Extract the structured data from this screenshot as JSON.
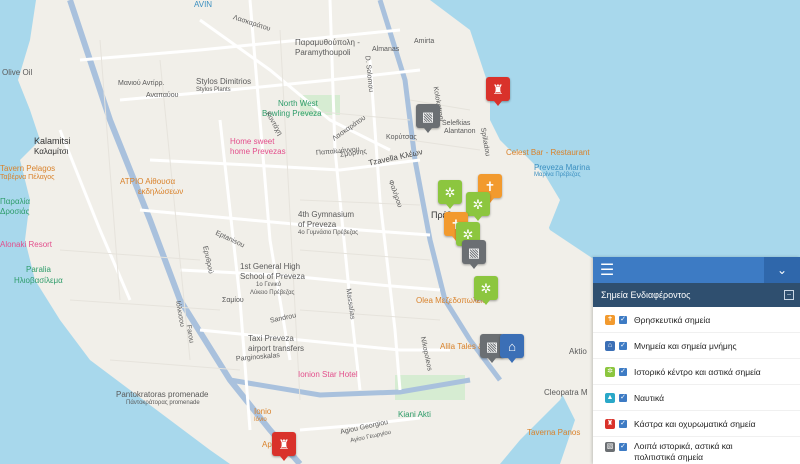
{
  "map": {
    "pois": [
      {
        "text": "Olive Oil",
        "color": "#5a5a5a"
      },
      {
        "text": "Kalamitsi",
        "color": "#333333"
      },
      {
        "text": "Καλαμίτσι",
        "color": "#333333"
      },
      {
        "text": "Tavern Pelagos",
        "color": "#d9822b"
      },
      {
        "text": "Ταβέρνα Πέλαγος",
        "color": "#d9822b"
      },
      {
        "text": "Παραλία",
        "color": "#2e9c6a"
      },
      {
        "text": "Δροσιάς",
        "color": "#2e9c6a"
      },
      {
        "text": "Alonaki Resort",
        "color": "#e34f8c"
      },
      {
        "text": "Paralia",
        "color": "#2e9c6a"
      },
      {
        "text": "Ηλιοβασίλεμα",
        "color": "#2e9c6a"
      },
      {
        "text": "ΑΤΡΙΟ Αίθουσα",
        "color": "#d9822b"
      },
      {
        "text": "εκδηλώσεων",
        "color": "#d9822b"
      },
      {
        "text": "Home sweet",
        "color": "#e34f8c"
      },
      {
        "text": "home Prevezas",
        "color": "#e34f8c"
      },
      {
        "text": "Stylos Dimitrios",
        "color": "#5a5a5a"
      },
      {
        "text": "Stylos Plants",
        "color": "#5a5a5a"
      },
      {
        "text": "Παραμυθούπολη -",
        "color": "#5a5a5a"
      },
      {
        "text": "Paramythoupoli",
        "color": "#5a5a5a"
      },
      {
        "text": "North West",
        "color": "#2e9c6a"
      },
      {
        "text": "Bowling Preveza",
        "color": "#2e9c6a"
      },
      {
        "text": "4th Gymnasium",
        "color": "#5a5a5a"
      },
      {
        "text": "of Preveza",
        "color": "#5a5a5a"
      },
      {
        "text": "4ο Γυμνάσιο Πρέβεζας",
        "color": "#5a5a5a"
      },
      {
        "text": "1st General High",
        "color": "#5a5a5a"
      },
      {
        "text": "School of Preveza",
        "color": "#5a5a5a"
      },
      {
        "text": "1ο Γενικό",
        "color": "#5a5a5a"
      },
      {
        "text": "Λύκειο Πρέβεζας",
        "color": "#5a5a5a"
      },
      {
        "text": "Taxi Preveza",
        "color": "#5a5a5a"
      },
      {
        "text": "airport transfers",
        "color": "#5a5a5a"
      },
      {
        "text": "Ionion Star Hotel",
        "color": "#e34f8c"
      },
      {
        "text": "Pantokratoras promenade",
        "color": "#5a5a5a"
      },
      {
        "text": "Πάντοκράτορας promenade",
        "color": "#5a5a5a"
      },
      {
        "text": "Ionio",
        "color": "#d9822b"
      },
      {
        "text": "Ιόνιο",
        "color": "#d9822b"
      },
      {
        "text": "Kiani Akti",
        "color": "#2e9c6a"
      },
      {
        "text": "Olea Μεζεδοπωλείο",
        "color": "#d9822b"
      },
      {
        "text": "Alila Tales &",
        "color": "#d9822b"
      },
      {
        "text": "Celest Bar - Restaurant",
        "color": "#d9822b"
      },
      {
        "text": "Preveza Marina",
        "color": "#3b8fc0"
      },
      {
        "text": "Μαρίνα Πρέβεζας",
        "color": "#3b8fc0"
      },
      {
        "text": "Taverna Panos",
        "color": "#d9822b"
      },
      {
        "text": "Cleopatra M",
        "color": "#5a5a5a"
      },
      {
        "text": "Aktio",
        "color": "#5a5a5a"
      },
      {
        "text": "Πρέβ",
        "color": "#333333"
      },
      {
        "text": "AVIN",
        "color": "#3b8fc0"
      },
      {
        "text": "Ap",
        "color": "#d9822b"
      }
    ],
    "streets": [
      "Λασκαράτου",
      "Almanas",
      "Amirta",
      "D. Solomou",
      "Selefkias",
      "Alantanon",
      "Λασκαράτου",
      "Tzavella Kλέων",
      "Κοντάχη",
      "Κoρύτσας",
      "Spiliadou",
      "Nikopoleos",
      "Eptanisou",
      "Παπαϊωάννου",
      "Massalias",
      "Sandrou",
      "Σαμίου",
      "Ερυθρού",
      "Ιόλκισου",
      "Parginoskalas",
      "Agiou Georgiou",
      "Αγίου Γεωργίου",
      "Kolokotroni",
      "Μανιού Αντίρρ.",
      "Αναπαύου",
      "Farou",
      "Σμύρνης",
      "Φαλήρου"
    ]
  },
  "panel": {
    "menu_icon": "hamburger-icon",
    "collapse_icon": "chevron-down-icon",
    "category_title": "Σημεία Ενδιαφέροντος",
    "categories": [
      {
        "label": "Θρησκευτικά σημεία",
        "icon_color": "#f29a2e",
        "checked": true
      },
      {
        "label": "Μνημεία και σημεία μνήμης",
        "icon_color": "#3b6fb6",
        "checked": true
      },
      {
        "label": "Ιστορικό κέντρο και αστικά σημεία",
        "icon_color": "#8cc63f",
        "checked": true
      },
      {
        "label": "Ναυτικά",
        "icon_color": "#2aa8c8",
        "checked": true
      },
      {
        "label": "Κάστρα και οχυρωματικά σημεία",
        "icon_color": "#d9322b",
        "checked": true
      },
      {
        "label": "Λοιπά ιστορικά, αστικά και",
        "icon_color": "#6b6f73",
        "checked": true
      },
      {
        "label": "πολιτιστικά σημεία",
        "icon_color": "#6b6f73",
        "checked": true
      }
    ]
  },
  "colors": {
    "water": "#9fd3e8",
    "land": "#f1efe9",
    "road": "#ffffff",
    "main_road": "#a9c1dd",
    "accent": "#3d7bc4"
  }
}
